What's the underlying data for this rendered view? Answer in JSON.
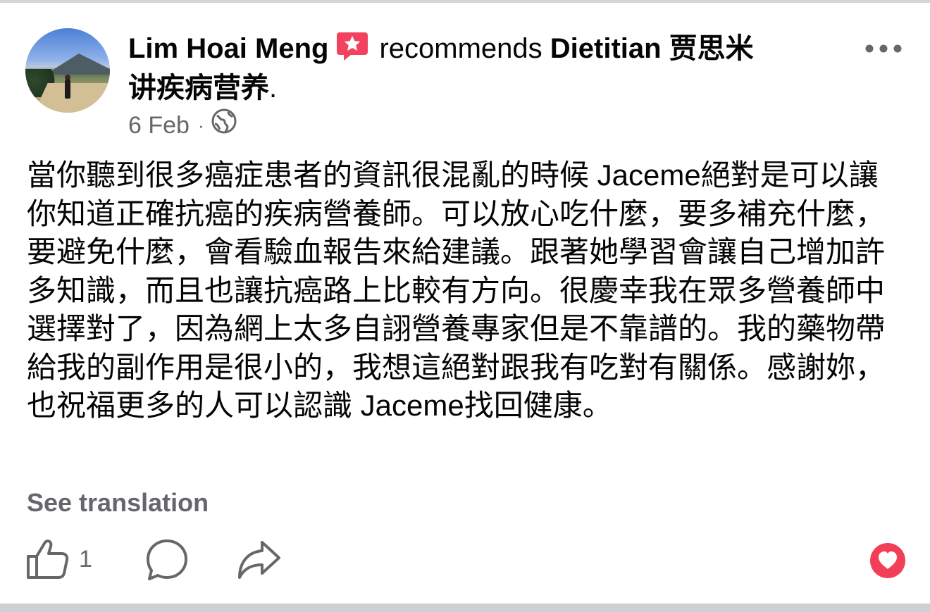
{
  "post": {
    "author": "Lim Hoai Meng",
    "verb": "recommends",
    "page_name_line1": "Dietitian 贾思米",
    "page_name_line2": "讲疾病营养",
    "period": ".",
    "date": "6 Feb",
    "separator": "·",
    "audience_icon": "globe-icon",
    "body": "當你聽到很多癌症患者的資訊很混亂的時候 Jaceme絕對是可以讓你知道正確抗癌的疾病營養師。可以放心吃什麼，要多補充什麼，要避免什麼，會看驗血報告來給建議。跟著她學習會讓自己增加許多知識，而且也讓抗癌路上比較有方向。很慶幸我在眾多營養師中選擇對了，因為網上太多自詡營養專家但是不靠譜的。我的藥物帶給我的副作用是很小的，我想這絕對跟我有吃對有關係。感謝妳，也祝福更多的人可以認識 Jaceme找回健康。",
    "see_translation": "See translation"
  },
  "reactions": {
    "like_count": "1"
  },
  "colors": {
    "text": "#050505",
    "secondary": "#65676b",
    "recommend_badge": "#f3425f",
    "love": "#f33e58"
  },
  "icons": [
    "recommend-star-icon",
    "more-options-icon",
    "globe-icon",
    "like-icon",
    "comment-icon",
    "share-icon",
    "love-reaction-icon"
  ]
}
